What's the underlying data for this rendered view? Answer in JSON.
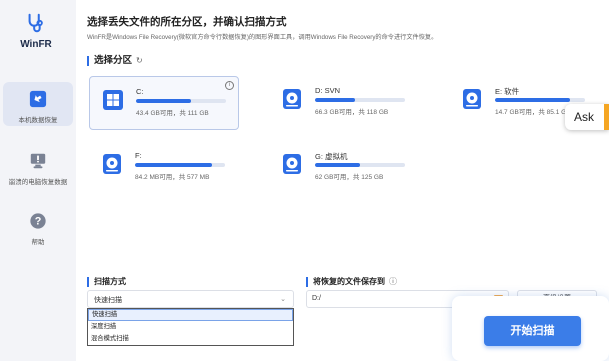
{
  "app": {
    "name": "WinFR"
  },
  "sidebar": {
    "items": [
      {
        "label": "本机数据恢复",
        "icon": "local-recovery-icon",
        "active": true
      },
      {
        "label": "崩溃的电脑恢复数据",
        "icon": "crashed-pc-icon",
        "active": false
      },
      {
        "label": "帮助",
        "icon": "help-icon",
        "active": false
      }
    ]
  },
  "header": {
    "title": "选择丢失文件的所在分区，并确认扫描方式",
    "subtitle": "WinFR是Windows File Recovery(微软官方命令行数据恢复)的图形界面工具，调用Windows File Recovery的命令进行文件恢复。"
  },
  "partition_section": {
    "title": "选择分区",
    "refresh_icon": "refresh-icon"
  },
  "drives": [
    {
      "name": "C:",
      "info": "43.4 GB可用，共 111 GB",
      "used_fraction": 0.61,
      "selected": true,
      "icon": "windows-drive-icon"
    },
    {
      "name": "D: SVN",
      "info": "66.3 GB可用，共 118 GB",
      "used_fraction": 0.44,
      "selected": false,
      "icon": "disk-icon"
    },
    {
      "name": "E: 软件",
      "info": "14.7 GB可用，共 85.1 GB",
      "used_fraction": 0.83,
      "selected": false,
      "icon": "disk-icon"
    },
    {
      "name": "F:",
      "info": "84.2 MB可用，共 577 MB",
      "used_fraction": 0.85,
      "selected": false,
      "icon": "disk-icon"
    },
    {
      "name": "G: 虚拟机",
      "info": "62 GB可用，共 125 GB",
      "used_fraction": 0.5,
      "selected": false,
      "icon": "disk-icon"
    }
  ],
  "ask": {
    "label": "Ask"
  },
  "scan_mode": {
    "title": "扫描方式",
    "selected": "快速扫描",
    "options": [
      "快速扫描",
      "深度扫描",
      "混合模式扫描"
    ]
  },
  "save_path": {
    "title": "将恢复的文件保存到",
    "value": "D:/",
    "settings_label": "高级设置"
  },
  "start_button": {
    "label": "开始扫描"
  },
  "colors": {
    "accent": "#2d6de5",
    "button": "#3b7de8",
    "sidebar": "#f3f4f8"
  }
}
